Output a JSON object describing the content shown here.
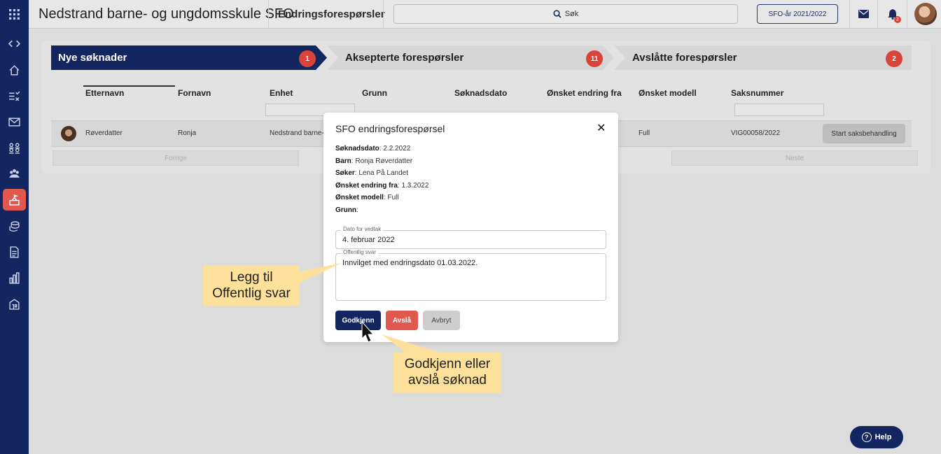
{
  "topbar": {
    "app_title": "Nedstrand barne- og ungdomsskule SFO",
    "page_title": "Endringsforespørsler",
    "search_label": "Søk",
    "sfo_year": "SFO-år 2021/2022",
    "notif_count": "2",
    "icons": [
      "grid-icon",
      "mail-icon",
      "bell-icon",
      "user-avatar"
    ]
  },
  "sidebar": {
    "icons": [
      "code-icon",
      "home-icon",
      "checklist-icon",
      "mail-icon",
      "people-icon",
      "group-icon",
      "school-icon",
      "coins-icon",
      "document-icon",
      "chart-icon",
      "building-icon"
    ]
  },
  "steps": [
    {
      "label": "Nye søknader",
      "count": "1"
    },
    {
      "label": "Aksepterte forespørsler",
      "count": "11"
    },
    {
      "label": "Avslåtte forespørsler",
      "count": "2"
    }
  ],
  "table": {
    "headers": [
      "Etternavn",
      "Fornavn",
      "Enhet",
      "Grunn",
      "Søknadsdato",
      "Ønsket endring fra",
      "Ønsket modell",
      "Saksnummer"
    ],
    "row": {
      "etternavn": "Røverdatter",
      "fornavn": "Ronja",
      "enhet": "Nedstrand barne-",
      "modell": "Full",
      "saksnummer": "VIG00058/2022",
      "action": "Start saksbehandling"
    },
    "prev": "Forrige",
    "next": "Neste"
  },
  "modal": {
    "title": "SFO endringsforespørsel",
    "info": [
      {
        "label": "Søknadsdato",
        "value": " 2.2.2022"
      },
      {
        "label": "Barn",
        "value": " Ronja Røverdatter"
      },
      {
        "label": "Søker",
        "value": " Lena På Landet"
      },
      {
        "label": "Ønsket endring fra",
        "value": " 1.3.2022"
      },
      {
        "label": "Ønsket modell",
        "value": " Full"
      },
      {
        "label": "Grunn",
        "value": ""
      }
    ],
    "date_label": "Dato for vedtak",
    "date_value": "4. februar 2022",
    "reply_label": "Offentlig svar",
    "reply_value": "Innvilget med endringsdato 01.03.2022.",
    "approve": "Godkjenn",
    "reject": "Avslå",
    "cancel": "Avbryt"
  },
  "callouts": {
    "left_line1": "Legg til",
    "left_line2": "Offentlig svar",
    "bottom_line1": "Godkjenn eller",
    "bottom_line2": "avslå søknad"
  },
  "help": "Help",
  "colors": {
    "navy": "#142660",
    "red": "#e0584e",
    "callout": "#fde19a"
  }
}
